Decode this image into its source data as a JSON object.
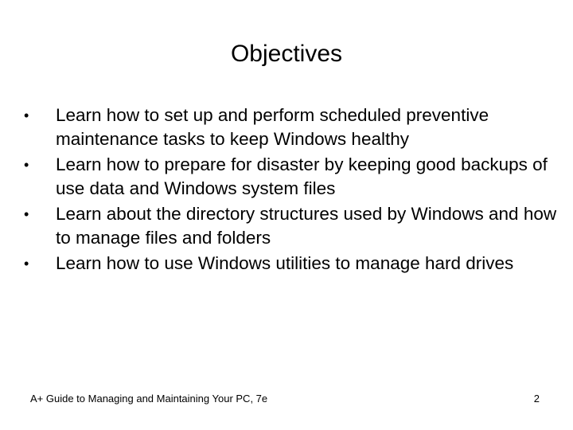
{
  "slide": {
    "title": "Objectives",
    "bullet_glyph": "•",
    "bullets": [
      "Learn how to set up and perform scheduled preventive maintenance tasks to keep Windows healthy",
      "Learn how to prepare for disaster by keeping good backups of use data and Windows system files",
      "Learn about the directory structures used by Windows and how to manage files and folders",
      "Learn how to use Windows utilities to manage hard drives"
    ],
    "footer": {
      "text": "A+ Guide to Managing and Maintaining Your PC, 7e",
      "page_number": "2"
    }
  }
}
